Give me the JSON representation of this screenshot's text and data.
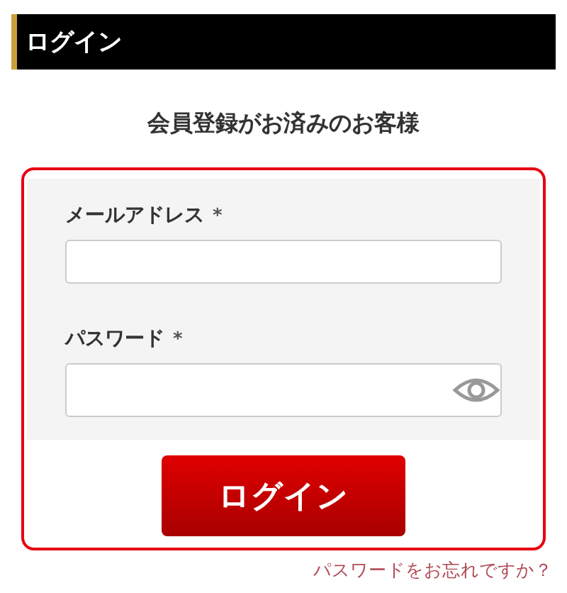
{
  "header": {
    "title": "ログイン"
  },
  "heading": "会員登録がお済みのお客様",
  "fields": [
    {
      "kind": "email",
      "label": "メールアドレス",
      "required_mark": "*"
    },
    {
      "kind": "password",
      "label": "パスワード",
      "required_mark": "*"
    }
  ],
  "login_button": "ログイン",
  "forgot_link": "パスワードをお忘れですか？"
}
